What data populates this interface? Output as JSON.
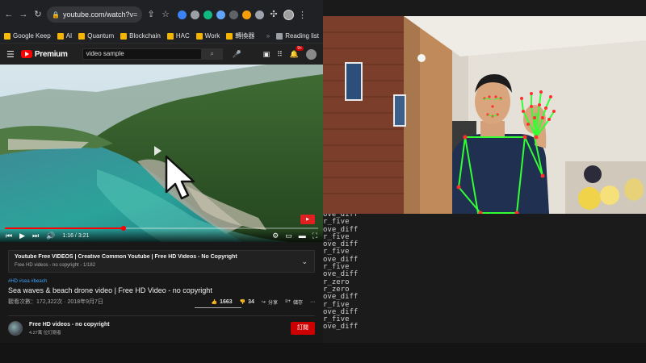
{
  "browser": {
    "url": "youtube.com/watch?v=...",
    "bookmarks": [
      "Google Keep",
      "AI",
      "Quantum",
      "Blockchain",
      "HAC",
      "Work",
      "轉換器"
    ],
    "reading_list": "Reading list",
    "more": "»"
  },
  "youtube": {
    "logo": "Premium",
    "search_value": "video sample",
    "notification_count": "9+",
    "player": {
      "time": "1:16 / 3:21",
      "progress_fraction": 0.378
    },
    "playlist": {
      "title": "Youtube Free VIDEOS | Creative Common Youtube | Free HD Videos - No Copyright",
      "subtitle": "Free HD videos - no copyright - 1/182"
    },
    "video": {
      "tags": "#HD #sea #beach",
      "title": "Sea waves & beach drone video | Free HD Video - no copyright",
      "views": "觀看次數：172,322次 · 2018年9月7日",
      "likes": "1663",
      "dislikes": "34",
      "share": "分享",
      "save": "儲存"
    },
    "channel": {
      "name": "Free HD videos - no copyright",
      "subscribers": "4.27萬 位訂閱者",
      "subscribe_label": "訂閱"
    }
  },
  "terminal": {
    "lines": [
      "ove_diff",
      "r_five",
      "ove_diff",
      "r_five",
      "ove_diff",
      "r_five",
      "ove_diff",
      "r_five",
      "ove_diff",
      "r_zero",
      "r_zero",
      "ove_diff",
      "r_five",
      "ove_diff",
      "r_five",
      "ove_diff"
    ]
  },
  "colors": {
    "accent": "#ff0000",
    "subscribe": "#cc0000",
    "skeleton": "#33ff33",
    "landmark": "#ff3030"
  }
}
